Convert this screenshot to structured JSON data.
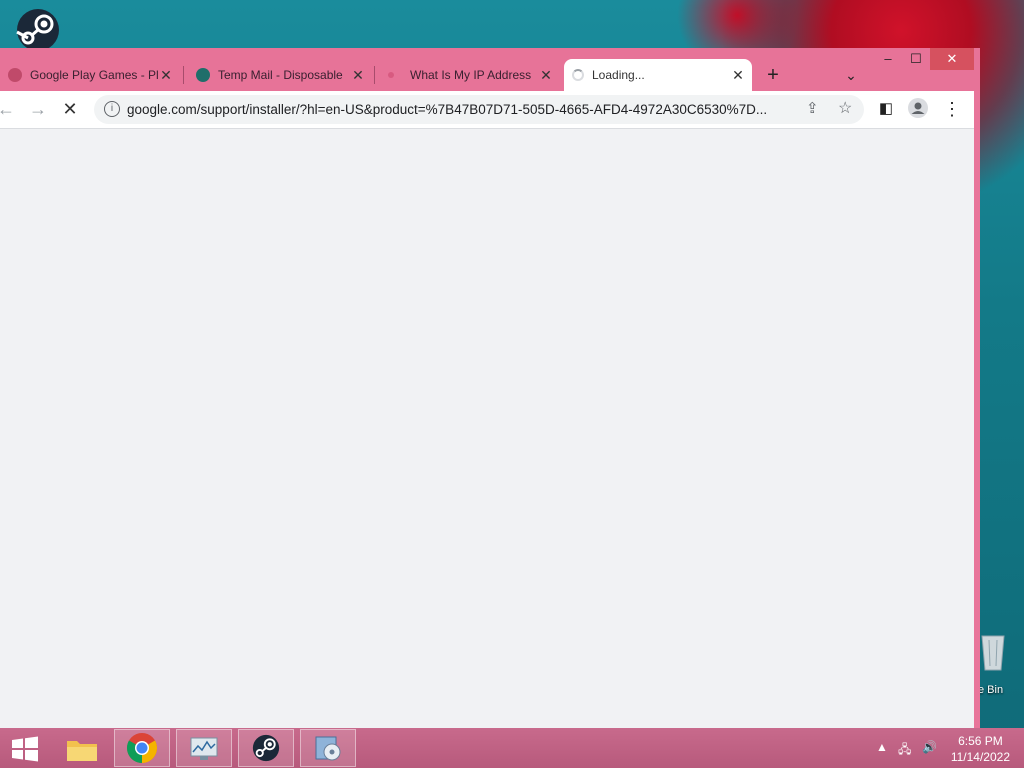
{
  "desktop": {
    "recycle_bin_label": "e Bin"
  },
  "browser": {
    "tabs": [
      {
        "title": "Google Play Games - Pl",
        "active": false,
        "favicon_color": "#c04a6a"
      },
      {
        "title": "Temp Mail - Disposable",
        "active": false,
        "favicon_color": "#1f6e6a"
      },
      {
        "title": "What Is My IP Address",
        "active": false,
        "favicon_color": "#d85a80"
      },
      {
        "title": "Loading...",
        "active": true,
        "favicon_color": "#9aa0a6"
      }
    ],
    "new_tab_label": "+",
    "url": "google.com/support/installer/?hl=en-US&product=%7B47B07D71-505D-4665-AFD4-4972A30C6530%7D...",
    "frame_color": "#e77398"
  },
  "taskbar": {
    "apps": [
      "start-button",
      "file-explorer",
      "chrome",
      "resource-monitor",
      "steam",
      "installer"
    ],
    "time": "6:56 PM",
    "date": "11/14/2022"
  }
}
